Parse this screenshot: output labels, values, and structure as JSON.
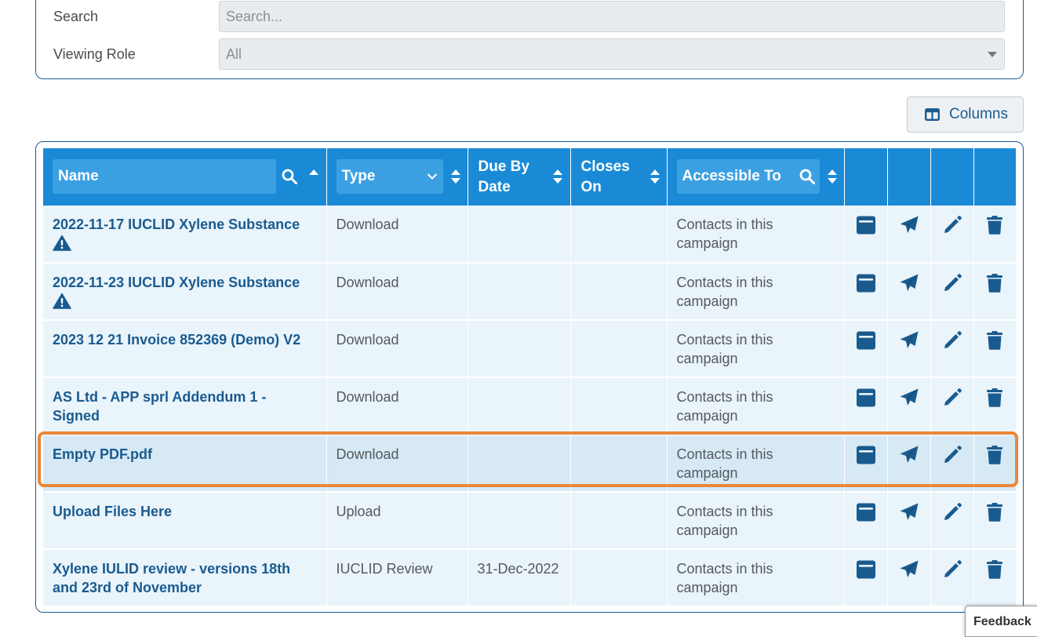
{
  "filters": {
    "search_label": "Search",
    "search_placeholder": "Search...",
    "role_label": "Viewing Role",
    "role_value": "All"
  },
  "toolbar": {
    "columns_label": "Columns"
  },
  "table": {
    "headers": {
      "name": "Name",
      "type": "Type",
      "due_line1": "Due By",
      "due_line2": "Date",
      "closes_line1": "Closes",
      "closes_line2": "On",
      "accessible": "Accessible To"
    },
    "rows": [
      {
        "name": "2022-11-17 IUCLID Xylene Substance",
        "warning": true,
        "type": "Download",
        "due": "",
        "closes": "",
        "accessible_line1": "Contacts in this",
        "accessible_line2": "campaign"
      },
      {
        "name": "2022-11-23 IUCLID Xylene Substance",
        "warning": true,
        "type": "Download",
        "due": "",
        "closes": "",
        "accessible_line1": "Contacts in this",
        "accessible_line2": "campaign"
      },
      {
        "name": "2023 12 21 Invoice 852369 (Demo) V2",
        "warning": false,
        "type": "Download",
        "due": "",
        "closes": "",
        "accessible_line1": "Contacts in this",
        "accessible_line2": "campaign"
      },
      {
        "name": "AS Ltd - APP sprl Addendum 1 - Signed",
        "warning": false,
        "type": "Download",
        "due": "",
        "closes": "",
        "accessible_line1": "Contacts in this",
        "accessible_line2": "campaign"
      },
      {
        "name": "Empty PDF.pdf",
        "warning": false,
        "type": "Download",
        "due": "",
        "closes": "",
        "accessible_line1": "Contacts in this",
        "accessible_line2": "campaign"
      },
      {
        "name": "Upload Files Here",
        "warning": false,
        "type": "Upload",
        "due": "",
        "closes": "",
        "accessible_line1": "Contacts in this",
        "accessible_line2": "campaign"
      },
      {
        "name": "Xylene IULID review - versions 18th and 23rd of November",
        "warning": false,
        "type": "IUCLID Review",
        "due": "31-Dec-2022",
        "closes": "",
        "accessible_line1": "Contacts in this",
        "accessible_line2": "campaign"
      }
    ]
  },
  "icons": {
    "actions": [
      "archive-icon",
      "send-icon",
      "edit-icon",
      "trash-icon"
    ],
    "warning": "warning-icon"
  },
  "colors": {
    "header_bg": "#1b8ad6",
    "row_bg": "#e9f4fb",
    "link": "#1a5b8f",
    "highlight": "#e8873a"
  },
  "feedback": {
    "label": "Feedback"
  }
}
